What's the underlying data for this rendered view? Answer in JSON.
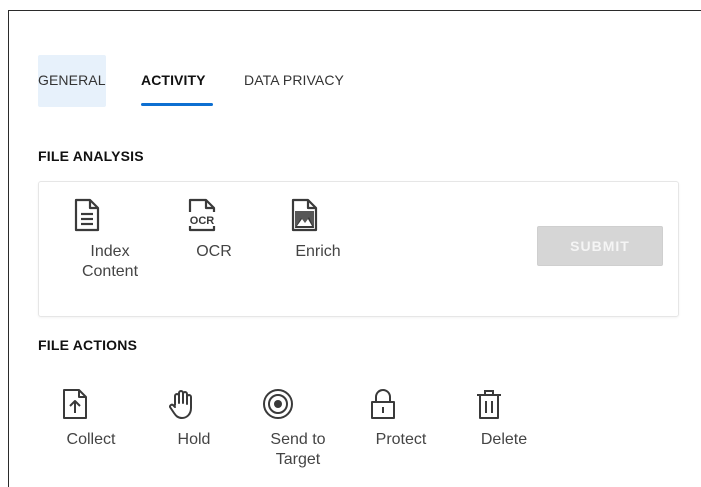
{
  "tabs": [
    {
      "label": "GENERAL",
      "active": false
    },
    {
      "label": "ACTIVITY",
      "active": true
    },
    {
      "label": "DATA PRIVACY",
      "active": false
    }
  ],
  "file_analysis": {
    "title": "FILE ANALYSIS",
    "items": [
      {
        "label_line1": "Index",
        "label_line2": "Content",
        "icon": "document-icon"
      },
      {
        "label_line1": "OCR",
        "label_line2": "",
        "icon": "ocr-icon"
      },
      {
        "label_line1": "Enrich",
        "label_line2": "",
        "icon": "image-icon"
      }
    ],
    "submit_label": "SUBMIT",
    "submit_enabled": false
  },
  "file_actions": {
    "title": "FILE ACTIONS",
    "items": [
      {
        "label_line1": "Collect",
        "label_line2": "",
        "icon": "upload-file-icon"
      },
      {
        "label_line1": "Hold",
        "label_line2": "",
        "icon": "hand-icon"
      },
      {
        "label_line1": "Send to",
        "label_line2": "Target",
        "icon": "target-icon"
      },
      {
        "label_line1": "Protect",
        "label_line2": "",
        "icon": "lock-icon"
      },
      {
        "label_line1": "Delete",
        "label_line2": "",
        "icon": "trash-icon"
      }
    ]
  },
  "colors": {
    "accent": "#0d6fd1",
    "tab_highlight": "#e7f1fb",
    "submit_disabled_bg": "#d6d6d6",
    "icon": "#3a3a3a"
  }
}
